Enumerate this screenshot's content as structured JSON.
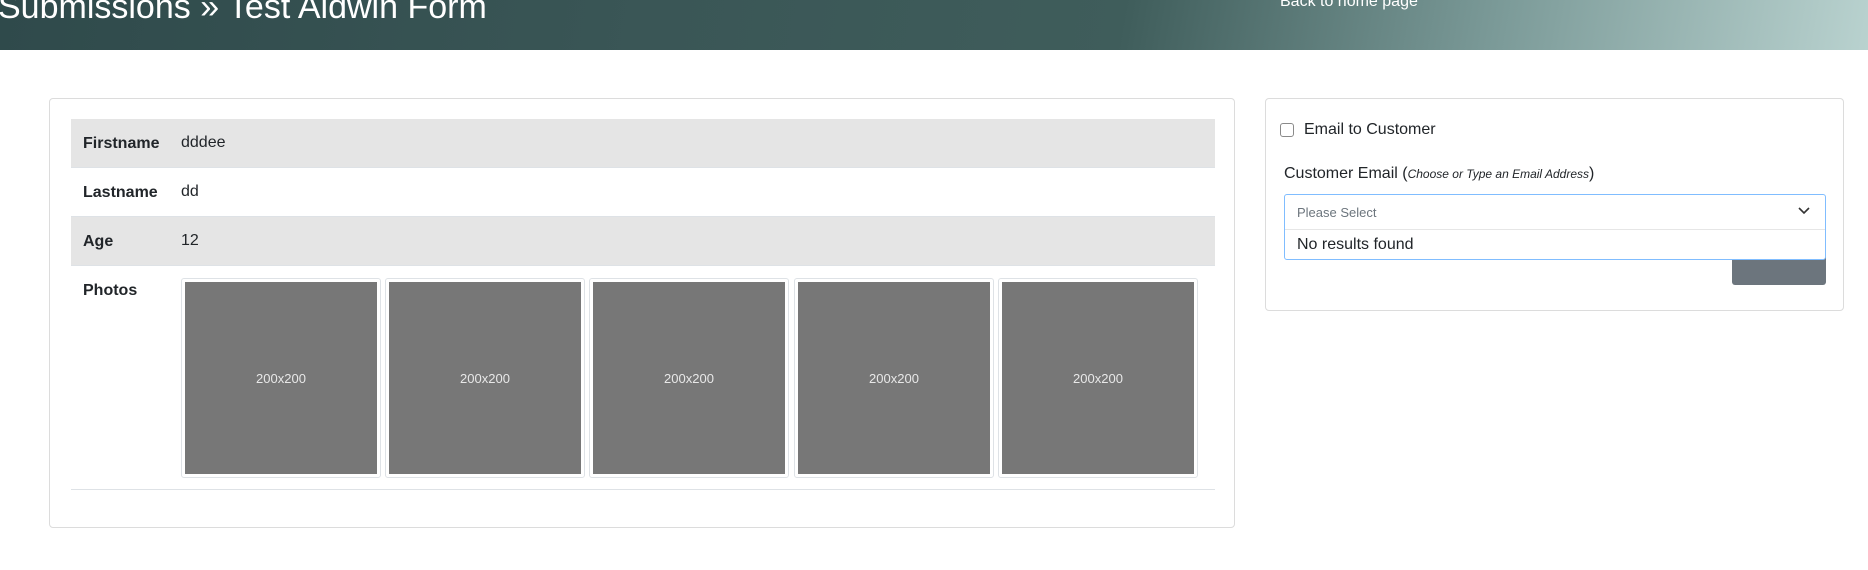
{
  "header": {
    "title": "Submissions » Test Aldwin Form",
    "back_link": "Back to home page"
  },
  "submission": {
    "fields": [
      {
        "label": "Firstname",
        "value": "dddee"
      },
      {
        "label": "Lastname",
        "value": "dd"
      },
      {
        "label": "Age",
        "value": "12"
      },
      {
        "label": "Photos",
        "value": ""
      }
    ],
    "photos": [
      "200x200",
      "200x200",
      "200x200",
      "200x200",
      "200x200"
    ]
  },
  "email_panel": {
    "checkbox_label": "Email to Customer",
    "checkbox_checked": false,
    "field_label": "Customer Email (",
    "field_hint": "Choose or Type an Email Address",
    "field_label_close": ")",
    "select_placeholder": "Please Select",
    "no_results": "No results found"
  },
  "colors": {
    "header_dark": "#2f4a4b",
    "header_light": "#b9d2cf",
    "row_stripe": "#e5e5e5",
    "photo_placeholder": "#777777",
    "focus_border": "#80bdff"
  },
  "icons": {
    "select": "chevron-down-icon"
  }
}
